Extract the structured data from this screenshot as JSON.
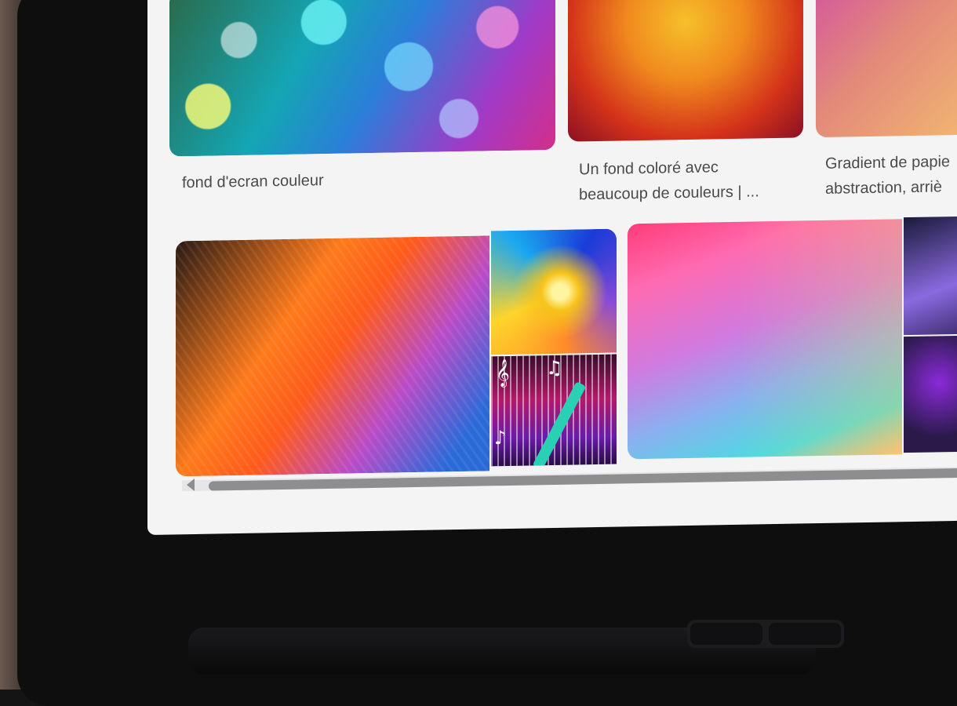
{
  "results": {
    "row1": [
      {
        "caption_line1": "fond d'ecran couleur",
        "caption_line2": ""
      },
      {
        "caption_line1": "Un fond coloré avec",
        "caption_line2": "beaucoup de couleurs | ..."
      },
      {
        "caption_line1": "Gradient de papie",
        "caption_line2": "abstraction, arriè"
      }
    ]
  },
  "icons": {
    "scroll_left": "chevron-left-icon",
    "music_notes": [
      "♪",
      "♫",
      "𝄞"
    ]
  },
  "colors": {
    "page_background": "#f4f4f5",
    "caption_text": "#4a4a4a",
    "scrollbar_thumb": "#8e8e90",
    "device_bezel": "#0e0e0f"
  }
}
